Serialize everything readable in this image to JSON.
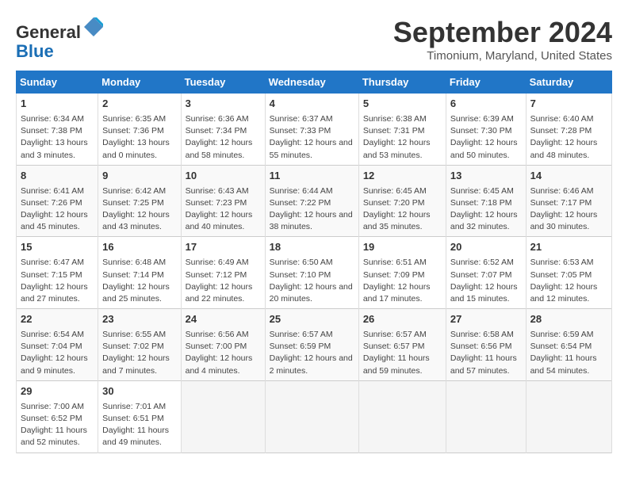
{
  "header": {
    "logo_line1": "General",
    "logo_line2": "Blue",
    "month_title": "September 2024",
    "location": "Timonium, Maryland, United States"
  },
  "weekdays": [
    "Sunday",
    "Monday",
    "Tuesday",
    "Wednesday",
    "Thursday",
    "Friday",
    "Saturday"
  ],
  "weeks": [
    [
      {
        "day": "1",
        "sunrise": "6:34 AM",
        "sunset": "7:38 PM",
        "daylight": "13 hours and 3 minutes."
      },
      {
        "day": "2",
        "sunrise": "6:35 AM",
        "sunset": "7:36 PM",
        "daylight": "13 hours and 0 minutes."
      },
      {
        "day": "3",
        "sunrise": "6:36 AM",
        "sunset": "7:34 PM",
        "daylight": "12 hours and 58 minutes."
      },
      {
        "day": "4",
        "sunrise": "6:37 AM",
        "sunset": "7:33 PM",
        "daylight": "12 hours and 55 minutes."
      },
      {
        "day": "5",
        "sunrise": "6:38 AM",
        "sunset": "7:31 PM",
        "daylight": "12 hours and 53 minutes."
      },
      {
        "day": "6",
        "sunrise": "6:39 AM",
        "sunset": "7:30 PM",
        "daylight": "12 hours and 50 minutes."
      },
      {
        "day": "7",
        "sunrise": "6:40 AM",
        "sunset": "7:28 PM",
        "daylight": "12 hours and 48 minutes."
      }
    ],
    [
      {
        "day": "8",
        "sunrise": "6:41 AM",
        "sunset": "7:26 PM",
        "daylight": "12 hours and 45 minutes."
      },
      {
        "day": "9",
        "sunrise": "6:42 AM",
        "sunset": "7:25 PM",
        "daylight": "12 hours and 43 minutes."
      },
      {
        "day": "10",
        "sunrise": "6:43 AM",
        "sunset": "7:23 PM",
        "daylight": "12 hours and 40 minutes."
      },
      {
        "day": "11",
        "sunrise": "6:44 AM",
        "sunset": "7:22 PM",
        "daylight": "12 hours and 38 minutes."
      },
      {
        "day": "12",
        "sunrise": "6:45 AM",
        "sunset": "7:20 PM",
        "daylight": "12 hours and 35 minutes."
      },
      {
        "day": "13",
        "sunrise": "6:45 AM",
        "sunset": "7:18 PM",
        "daylight": "12 hours and 32 minutes."
      },
      {
        "day": "14",
        "sunrise": "6:46 AM",
        "sunset": "7:17 PM",
        "daylight": "12 hours and 30 minutes."
      }
    ],
    [
      {
        "day": "15",
        "sunrise": "6:47 AM",
        "sunset": "7:15 PM",
        "daylight": "12 hours and 27 minutes."
      },
      {
        "day": "16",
        "sunrise": "6:48 AM",
        "sunset": "7:14 PM",
        "daylight": "12 hours and 25 minutes."
      },
      {
        "day": "17",
        "sunrise": "6:49 AM",
        "sunset": "7:12 PM",
        "daylight": "12 hours and 22 minutes."
      },
      {
        "day": "18",
        "sunrise": "6:50 AM",
        "sunset": "7:10 PM",
        "daylight": "12 hours and 20 minutes."
      },
      {
        "day": "19",
        "sunrise": "6:51 AM",
        "sunset": "7:09 PM",
        "daylight": "12 hours and 17 minutes."
      },
      {
        "day": "20",
        "sunrise": "6:52 AM",
        "sunset": "7:07 PM",
        "daylight": "12 hours and 15 minutes."
      },
      {
        "day": "21",
        "sunrise": "6:53 AM",
        "sunset": "7:05 PM",
        "daylight": "12 hours and 12 minutes."
      }
    ],
    [
      {
        "day": "22",
        "sunrise": "6:54 AM",
        "sunset": "7:04 PM",
        "daylight": "12 hours and 9 minutes."
      },
      {
        "day": "23",
        "sunrise": "6:55 AM",
        "sunset": "7:02 PM",
        "daylight": "12 hours and 7 minutes."
      },
      {
        "day": "24",
        "sunrise": "6:56 AM",
        "sunset": "7:00 PM",
        "daylight": "12 hours and 4 minutes."
      },
      {
        "day": "25",
        "sunrise": "6:57 AM",
        "sunset": "6:59 PM",
        "daylight": "12 hours and 2 minutes."
      },
      {
        "day": "26",
        "sunrise": "6:57 AM",
        "sunset": "6:57 PM",
        "daylight": "11 hours and 59 minutes."
      },
      {
        "day": "27",
        "sunrise": "6:58 AM",
        "sunset": "6:56 PM",
        "daylight": "11 hours and 57 minutes."
      },
      {
        "day": "28",
        "sunrise": "6:59 AM",
        "sunset": "6:54 PM",
        "daylight": "11 hours and 54 minutes."
      }
    ],
    [
      {
        "day": "29",
        "sunrise": "7:00 AM",
        "sunset": "6:52 PM",
        "daylight": "11 hours and 52 minutes."
      },
      {
        "day": "30",
        "sunrise": "7:01 AM",
        "sunset": "6:51 PM",
        "daylight": "11 hours and 49 minutes."
      },
      {
        "day": "",
        "sunrise": "",
        "sunset": "",
        "daylight": ""
      },
      {
        "day": "",
        "sunrise": "",
        "sunset": "",
        "daylight": ""
      },
      {
        "day": "",
        "sunrise": "",
        "sunset": "",
        "daylight": ""
      },
      {
        "day": "",
        "sunrise": "",
        "sunset": "",
        "daylight": ""
      },
      {
        "day": "",
        "sunrise": "",
        "sunset": "",
        "daylight": ""
      }
    ]
  ]
}
